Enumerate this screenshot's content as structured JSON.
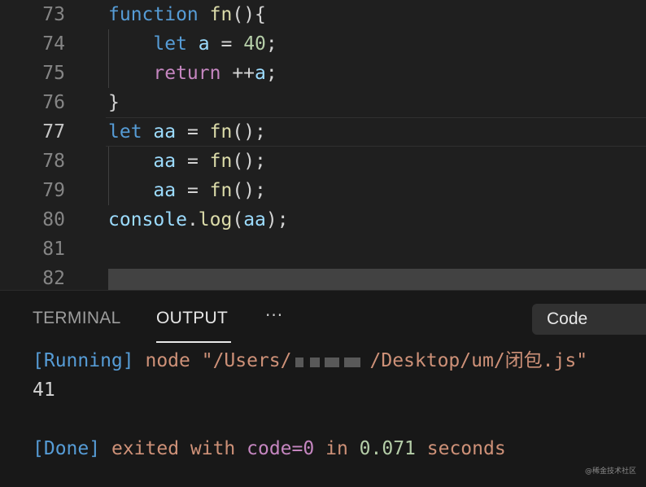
{
  "editor": {
    "lines": [
      {
        "n": "73",
        "tokens": [
          [
            "kw",
            "function"
          ],
          [
            "pun",
            " "
          ],
          [
            "fn",
            "fn"
          ],
          [
            "pun",
            "(){"
          ]
        ]
      },
      {
        "n": "74",
        "tokens": [
          [
            "pun",
            "    "
          ],
          [
            "kw",
            "let"
          ],
          [
            "pun",
            " "
          ],
          [
            "var",
            "a"
          ],
          [
            "pun",
            " = "
          ],
          [
            "num",
            "40"
          ],
          [
            "pun",
            ";"
          ]
        ]
      },
      {
        "n": "75",
        "tokens": [
          [
            "pun",
            "    "
          ],
          [
            "ctl",
            "return"
          ],
          [
            "pun",
            " ++"
          ],
          [
            "var",
            "a"
          ],
          [
            "pun",
            ";"
          ]
        ]
      },
      {
        "n": "76",
        "tokens": [
          [
            "pun",
            "}"
          ]
        ]
      },
      {
        "n": "77",
        "tokens": [
          [
            "kw",
            "let"
          ],
          [
            "pun",
            " "
          ],
          [
            "var",
            "aa"
          ],
          [
            "pun",
            " = "
          ],
          [
            "fn",
            "fn"
          ],
          [
            "pun",
            "();"
          ]
        ]
      },
      {
        "n": "78",
        "tokens": [
          [
            "pun",
            "    "
          ],
          [
            "var",
            "aa"
          ],
          [
            "pun",
            " = "
          ],
          [
            "fn",
            "fn"
          ],
          [
            "pun",
            "();"
          ]
        ]
      },
      {
        "n": "79",
        "tokens": [
          [
            "pun",
            "    "
          ],
          [
            "var",
            "aa"
          ],
          [
            "pun",
            " = "
          ],
          [
            "fn",
            "fn"
          ],
          [
            "pun",
            "();"
          ]
        ]
      },
      {
        "n": "80",
        "tokens": [
          [
            "var",
            "console"
          ],
          [
            "pun",
            "."
          ],
          [
            "fn",
            "log"
          ],
          [
            "pun",
            "("
          ],
          [
            "var",
            "aa"
          ],
          [
            "pun",
            ");"
          ]
        ]
      },
      {
        "n": "81",
        "tokens": []
      },
      {
        "n": "82",
        "tokens": []
      }
    ],
    "active_line": "77"
  },
  "panel": {
    "tabs": [
      "TERMINAL",
      "OUTPUT"
    ],
    "active_tab": "OUTPUT",
    "more_label": "···",
    "channel_select": "Code",
    "output": {
      "running_tag": "[Running]",
      "command_prefix": "node \"/Users/",
      "command_suffix": "/Desktop/um/闭包.js\"",
      "result": "41",
      "done_tag": "[Done]",
      "exit_text": "exited with",
      "code_text": "code=0",
      "in_text": "in",
      "duration": "0.071",
      "seconds_text": "seconds"
    }
  },
  "watermark": "@稀金技术社区"
}
